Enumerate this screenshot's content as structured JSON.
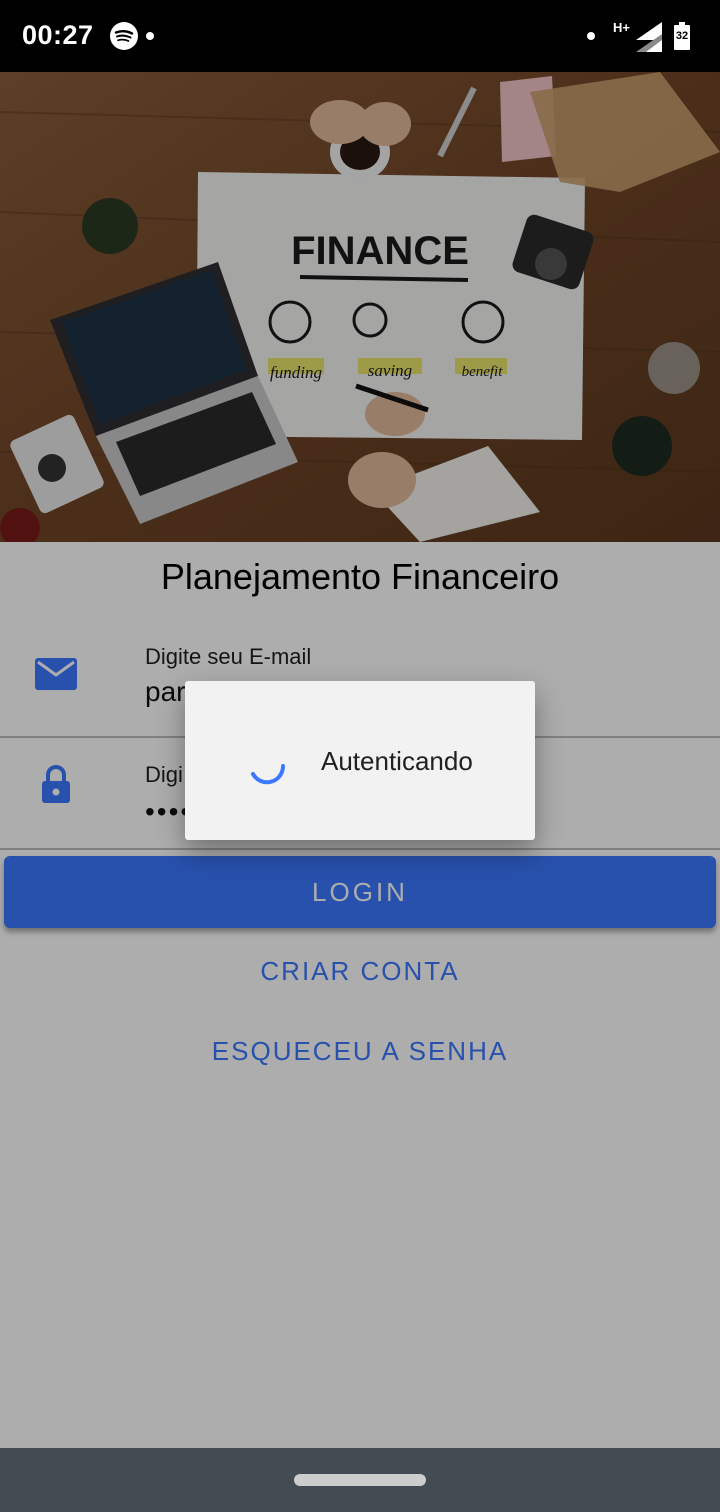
{
  "status_bar": {
    "time": "00:27",
    "network_type": "H+",
    "battery_level": "32",
    "icons": [
      "spotify-icon",
      "signal-icon",
      "battery-icon"
    ]
  },
  "hero": {
    "alt_icon": "finance-illustration-photo",
    "sketch": {
      "heading": "FINANCE",
      "labels": [
        "funding",
        "saving",
        "benefit"
      ]
    }
  },
  "app": {
    "title": "Planejamento Financeiro"
  },
  "form": {
    "email": {
      "label": "Digite seu E-mail",
      "value": "par",
      "icon": "mail-icon"
    },
    "password": {
      "label": "Digi",
      "value": "••••",
      "icon": "lock-icon"
    },
    "login_label": "LOGIN",
    "create_account_label": "CRIAR CONTA",
    "forgot_password_label": "ESQUECEU A SENHA"
  },
  "dialog": {
    "message": "Autenticando"
  },
  "colors": {
    "primary": "#3b78ff",
    "status_bar": "#000000",
    "nav_bar": "#454b53",
    "dialog_bg": "#f2f2f2"
  }
}
